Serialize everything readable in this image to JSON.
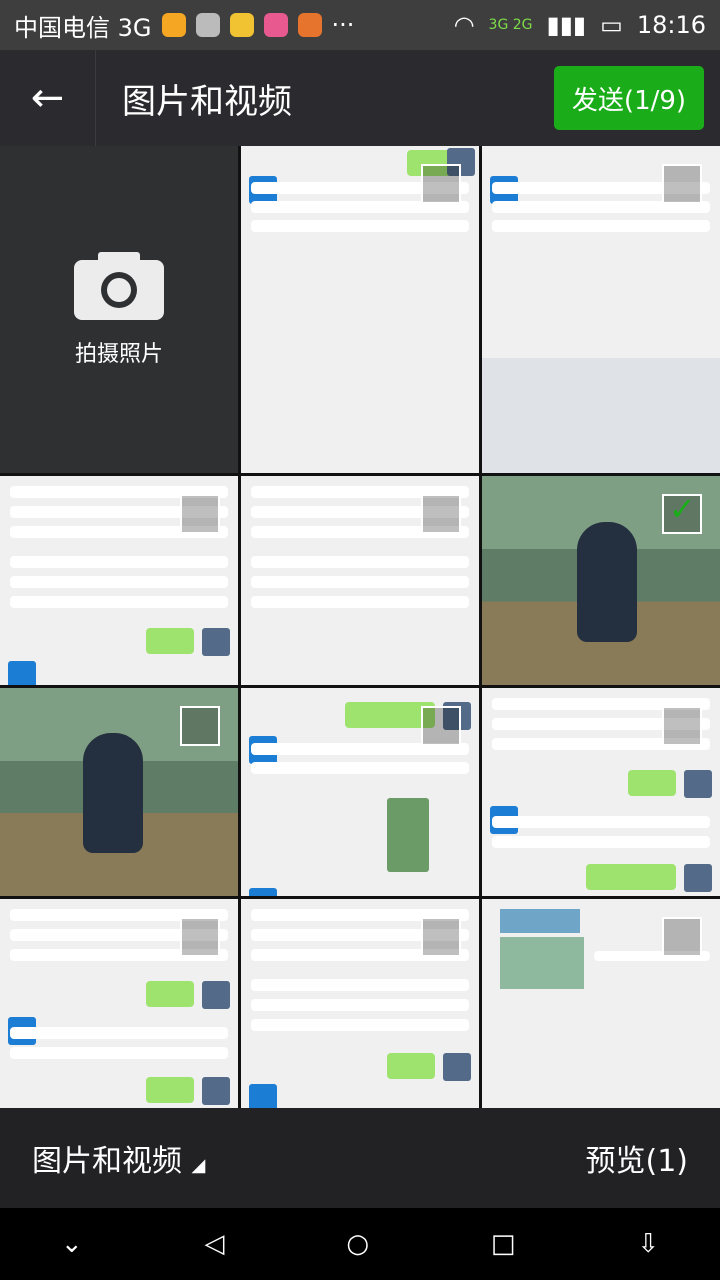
{
  "status": {
    "carrier": "中国电信 3G",
    "time": "18:16",
    "more": "···",
    "network": "3G 2G"
  },
  "header": {
    "title": "图片和视频",
    "send_label": "发送(1/9)"
  },
  "camera": {
    "label": "拍摄照片"
  },
  "bottom": {
    "album_label": "图片和视频",
    "preview_label": "预览(1)"
  },
  "grid": {
    "selected_index": 4
  }
}
